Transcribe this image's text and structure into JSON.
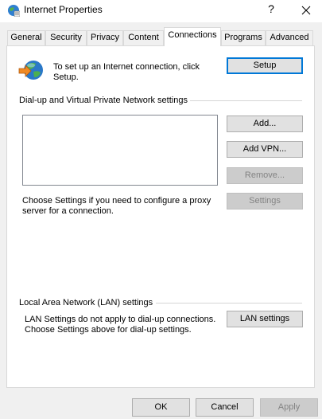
{
  "window": {
    "title": "Internet Properties",
    "help_glyph": "?"
  },
  "tabs": [
    {
      "label": "General",
      "active": false
    },
    {
      "label": "Security",
      "active": false
    },
    {
      "label": "Privacy",
      "active": false
    },
    {
      "label": "Content",
      "active": false
    },
    {
      "label": "Connections",
      "active": true
    },
    {
      "label": "Programs",
      "active": false
    },
    {
      "label": "Advanced",
      "active": false
    }
  ],
  "setup": {
    "text_line1": "To set up an Internet connection, click",
    "text_line2": "Setup.",
    "button": "Setup"
  },
  "dialup": {
    "heading": "Dial-up and Virtual Private Network settings",
    "add_button": "Add...",
    "add_vpn_button": "Add VPN...",
    "remove_button": "Remove...",
    "settings_button": "Settings",
    "proxy_line1": "Choose Settings if you need to configure a proxy",
    "proxy_line2": "server for a connection."
  },
  "lan": {
    "heading": "Local Area Network (LAN) settings",
    "text_line1": "LAN Settings do not apply to dial-up connections.",
    "text_line2": "Choose Settings above for dial-up settings.",
    "button": "LAN settings"
  },
  "footer": {
    "ok": "OK",
    "cancel": "Cancel",
    "apply": "Apply"
  },
  "colors": {
    "focus_border": "#0078d7",
    "disabled_text": "#838383"
  }
}
